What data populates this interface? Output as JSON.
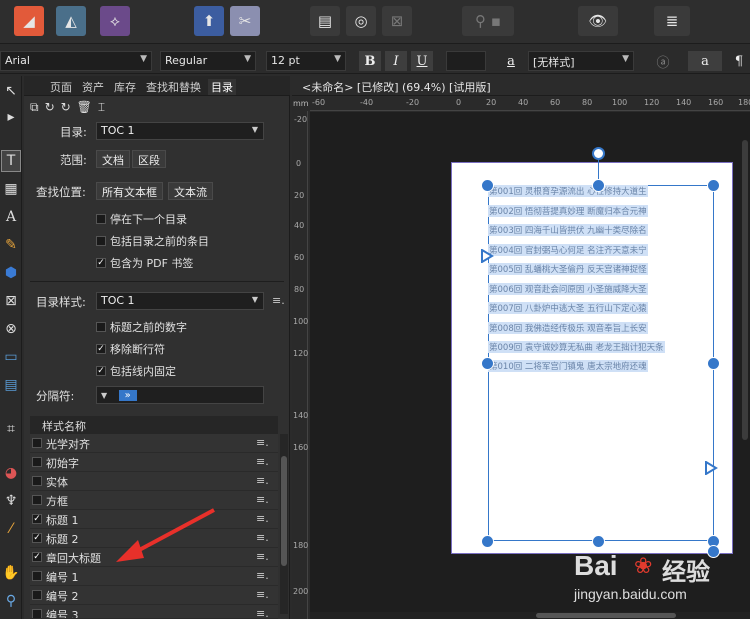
{
  "toolbar": {
    "personas": [
      "publisher-persona",
      "designer-persona",
      "photo-persona"
    ],
    "icons": [
      "share-icon",
      "color-adjust-icon",
      "frame-text-icon",
      "target-icon",
      "close-square-icon",
      "pin-icon",
      "square-icon",
      "eye-icon",
      "lines-icon"
    ]
  },
  "format": {
    "font": "Arial",
    "weight": "Regular",
    "size": "12 pt",
    "bold": "B",
    "italic": "I",
    "underline": "U",
    "style_name": "[无样式]",
    "char_a": "a",
    "char_a2": "a",
    "para_icon": "¶"
  },
  "panel": {
    "tabs": [
      "页面",
      "资产",
      "库存",
      "查找和替换",
      "目录"
    ],
    "toc_label": "目录:",
    "toc_value": "TOC 1",
    "scope_label": "范围:",
    "scope_doc": "文档",
    "scope_section": "区段",
    "find_label": "查找位置:",
    "find_all": "所有文本框",
    "find_flow": "文本流",
    "opt_stop": "停在下一个目录",
    "opt_include_before": "包括目录之前的条目",
    "opt_pdf": "包含为 PDF 书签",
    "toc_style_label": "目录样式:",
    "toc_style_value": "TOC 1",
    "opt_numbers": "标题之前的数字",
    "opt_remove_breaks": "移除断行符",
    "opt_inline": "包括线内固定",
    "separator_label": "分隔符:",
    "separator_value": "»",
    "style_col": "样式名称",
    "styles": [
      {
        "name": "光学对齐",
        "checked": false
      },
      {
        "name": "初始字",
        "checked": false
      },
      {
        "name": "实体",
        "checked": false
      },
      {
        "name": "方框",
        "checked": false
      },
      {
        "name": "标题 1",
        "checked": true
      },
      {
        "name": "标题 2",
        "checked": true
      },
      {
        "name": "章回大标题",
        "checked": true
      },
      {
        "name": "编号 1",
        "checked": false
      },
      {
        "name": "编号 2",
        "checked": false
      },
      {
        "name": "编号 3",
        "checked": false
      }
    ]
  },
  "document": {
    "title": "<未命名> [已修改] (69.4%) [试用版]",
    "ruler_unit": "mm",
    "hruler_ticks": [
      "-60",
      "-40",
      "-20",
      "0",
      "20",
      "40",
      "60",
      "80",
      "100",
      "120",
      "140",
      "160",
      "180"
    ],
    "vruler_ticks": [
      "-20",
      "0",
      "20",
      "40",
      "60",
      "80",
      "100",
      "120",
      "140",
      "160",
      "180",
      "200"
    ],
    "toc_lines": [
      "第001回 灵根育孕源流出 心性修持大道生",
      "第002回 悟彻菩提真妙理 断魔归本合元神",
      "第003回 四海千山皆拱伏 九幽十类尽除名",
      "第004回 官封弼马心何足 名注齐天意未宁",
      "第005回 乱蟠桃大圣偷丹 反天宫诸神捉怪",
      "第006回 观音赴会问原因 小圣施威降大圣",
      "第007回 八卦炉中逃大圣 五行山下定心猿",
      "第008回 我佛造经传极乐 观音奉旨上长安",
      "第009回 袁守诚妙算无私曲 老龙王拙计犯天条",
      "第010回 二将军宫门镇鬼 唐太宗地府还魂"
    ]
  },
  "watermark": {
    "brand": "Bai",
    "brand_cn": "经验",
    "url": "jingyan.baidu.com"
  }
}
